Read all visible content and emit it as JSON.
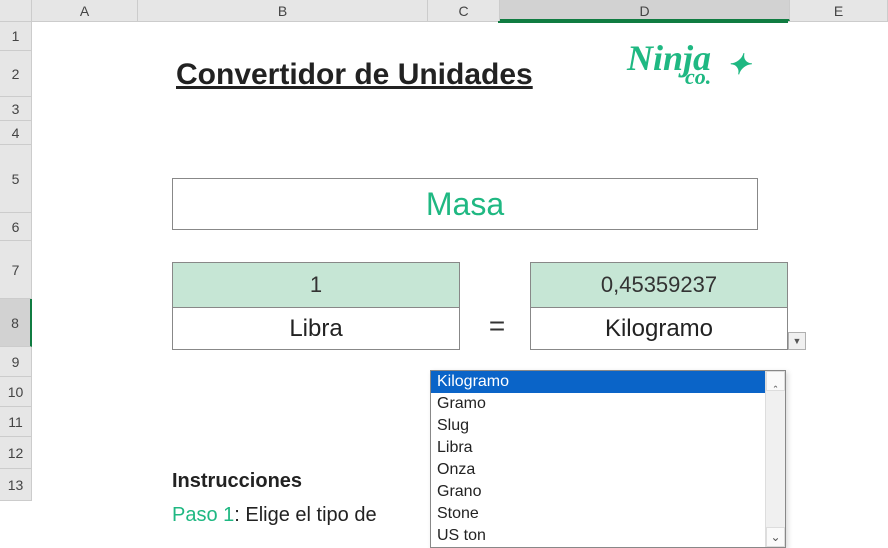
{
  "columns": [
    "A",
    "B",
    "C",
    "D",
    "E"
  ],
  "rows": [
    "1",
    "2",
    "3",
    "4",
    "5",
    "6",
    "7",
    "8",
    "9",
    "10",
    "11",
    "12",
    "13"
  ],
  "title": "Convertidor de Unidades",
  "logo": {
    "main": "Ninja",
    "sub": "co.",
    "spark": "✦"
  },
  "category": "Masa",
  "input": {
    "value": "1",
    "unit": "Libra"
  },
  "equals": "=",
  "output": {
    "value": "0,45359237",
    "unit": "Kilogramo"
  },
  "dropdown": {
    "options": [
      "Kilogramo",
      "Gramo",
      "Slug",
      "Libra",
      "Onza",
      "Grano",
      "Stone",
      "US ton"
    ],
    "selected_index": 0
  },
  "instructions": {
    "heading": "Instrucciones",
    "step1_label": "Paso 1",
    "step1_sep": ": ",
    "step1_text": "Elige el tipo de"
  }
}
